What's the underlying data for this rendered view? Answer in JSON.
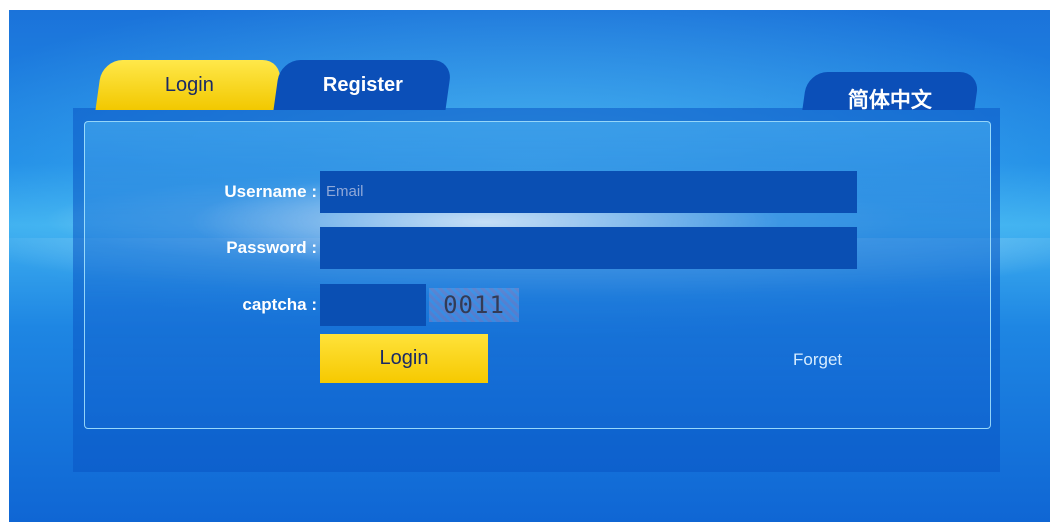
{
  "tabs": {
    "login": "Login",
    "register": "Register",
    "language": "简体中文"
  },
  "form": {
    "username_label": "Username :",
    "username_placeholder": "Email",
    "password_label": "Password :",
    "captcha_label": "captcha :",
    "captcha_code": "0011",
    "login_button": "Login",
    "forget_link": "Forget"
  },
  "colors": {
    "background_blue": "#1f8be6",
    "tab_active_yellow": "#f2c800",
    "tab_inactive_blue": "#0b4fb8",
    "input_blue": "#0a4fb3"
  }
}
